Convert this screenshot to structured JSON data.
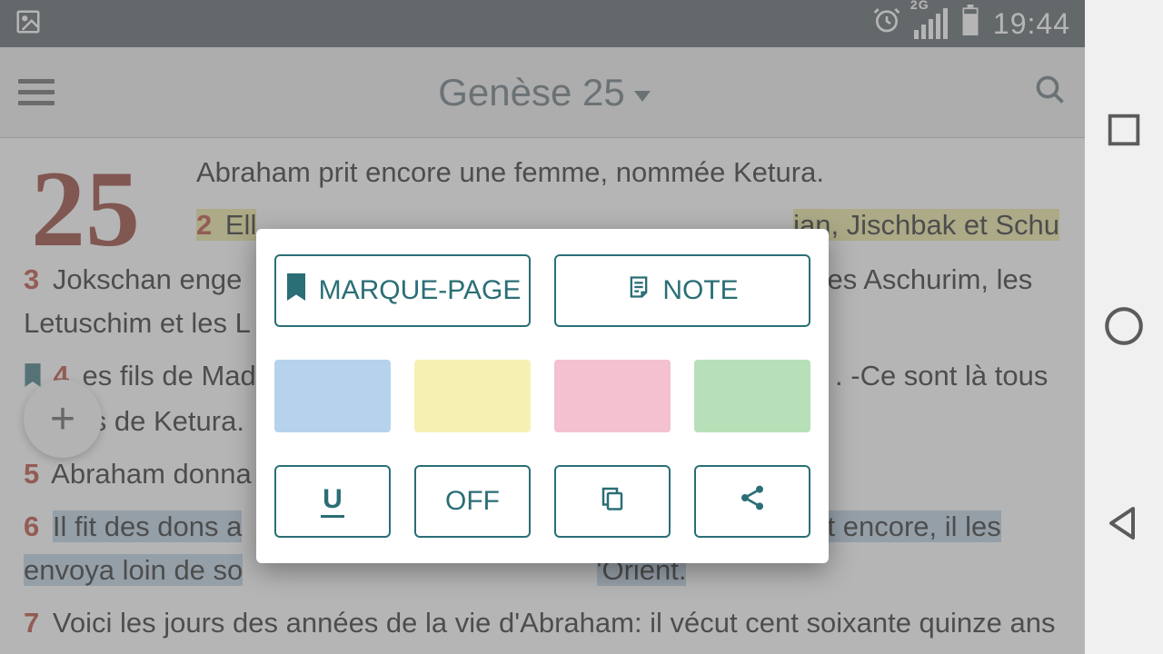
{
  "statusbar": {
    "network_label": "2G",
    "time": "19:44"
  },
  "appbar": {
    "title": "Genèse 25"
  },
  "chapter_number": "25",
  "verses": {
    "v1": {
      "text": "Abraham prit encore une femme, nommée Ketura."
    },
    "v2": {
      "num": "2",
      "text_a": "Ell",
      "text_b": "ian, Jischbak et Schu"
    },
    "v3": {
      "num": "3",
      "text_a": "Jokschan enge",
      "text_b": " les Aschurim, les Letuschim et les L"
    },
    "v4": {
      "num": "4",
      "text_a": "es fils de Mad",
      "text_b": ". -Ce sont là tous",
      "text_c": "ils de Ketura."
    },
    "v5": {
      "num": "5",
      "text": "Abraham donna"
    },
    "v6": {
      "num": "6",
      "text_a": "Il fit des dons a",
      "text_b": "it encore, il les envoya loin de so",
      "text_c": "'Orient."
    },
    "v7": {
      "num": "7",
      "text": "Voici les jours des années de la vie d'Abraham: il vécut cent soixante quinze ans"
    }
  },
  "popup": {
    "bookmark_label": "MARQUE-PAGE",
    "note_label": "NOTE",
    "underline_label": "U",
    "off_label": "OFF",
    "colors": {
      "blue": "#b6d3eb",
      "yellow": "#f6f1b3",
      "pink": "#f3c1cf",
      "green": "#b7e0b9"
    }
  },
  "accent": "#2a6e76"
}
